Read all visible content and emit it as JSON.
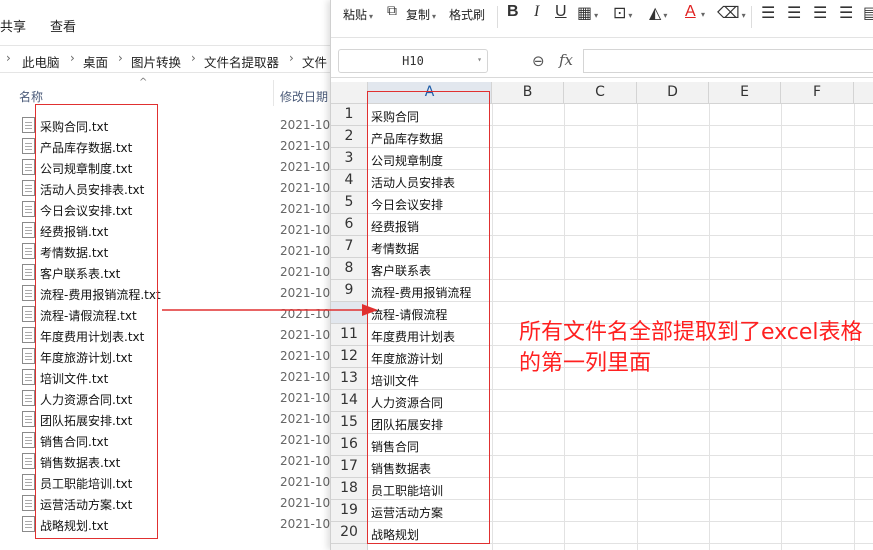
{
  "explorer": {
    "ribbon_tabs": [
      "共享",
      "查看"
    ],
    "breadcrumb": [
      "此电脑",
      "桌面",
      "图片转换",
      "文件名提取器",
      "文件"
    ],
    "columns": {
      "name": "名称",
      "date": "修改日期"
    },
    "files": [
      {
        "name": "采购合同.txt",
        "date": "2021-10-"
      },
      {
        "name": "产品库存数据.txt",
        "date": "2021-10-"
      },
      {
        "name": "公司规章制度.txt",
        "date": "2021-10-"
      },
      {
        "name": "活动人员安排表.txt",
        "date": "2021-10-"
      },
      {
        "name": "今日会议安排.txt",
        "date": "2021-10-"
      },
      {
        "name": "经费报销.txt",
        "date": "2021-10-"
      },
      {
        "name": "考情数据.txt",
        "date": "2021-10-"
      },
      {
        "name": "客户联系表.txt",
        "date": "2021-10-"
      },
      {
        "name": "流程-费用报销流程.txt",
        "date": "2021-10-"
      },
      {
        "name": "流程-请假流程.txt",
        "date": "2021-10-"
      },
      {
        "name": "年度费用计划表.txt",
        "date": "2021-10-"
      },
      {
        "name": "年度旅游计划.txt",
        "date": "2021-10-"
      },
      {
        "name": "培训文件.txt",
        "date": "2021-10-"
      },
      {
        "name": "人力资源合同.txt",
        "date": "2021-10-"
      },
      {
        "name": "团队拓展安排.txt",
        "date": "2021-10-"
      },
      {
        "name": "销售合同.txt",
        "date": "2021-10-"
      },
      {
        "name": "销售数据表.txt",
        "date": "2021-10-"
      },
      {
        "name": "员工职能培训.txt",
        "date": "2021-10-"
      },
      {
        "name": "运营活动方案.txt",
        "date": "2021-10-"
      },
      {
        "name": "战略规划.txt",
        "date": "2021-10-"
      }
    ]
  },
  "toolbar": {
    "paste_label": "粘贴",
    "copy_label": "复制",
    "format_painter_label": "格式刷",
    "bold_glyph": "B",
    "italic_glyph": "I",
    "underline_glyph": "U",
    "font_color_glyph": "A",
    "accent_red": "#e02020"
  },
  "formula_bar": {
    "cell_ref": "H10",
    "formula": ""
  },
  "sheet": {
    "columns": [
      "A",
      "B",
      "C",
      "D",
      "E",
      "F"
    ],
    "active_column": "A",
    "active_row": 10,
    "rows": [
      {
        "num": "1",
        "a": "采购合同"
      },
      {
        "num": "2",
        "a": "产品库存数据"
      },
      {
        "num": "3",
        "a": "公司规章制度"
      },
      {
        "num": "4",
        "a": "活动人员安排表"
      },
      {
        "num": "5",
        "a": "今日会议安排"
      },
      {
        "num": "6",
        "a": "经费报销"
      },
      {
        "num": "7",
        "a": "考情数据"
      },
      {
        "num": "8",
        "a": "客户联系表"
      },
      {
        "num": "9",
        "a": "流程-费用报销流程"
      },
      {
        "num": "",
        "a": "流程-请假流程"
      },
      {
        "num": "11",
        "a": "年度费用计划表"
      },
      {
        "num": "12",
        "a": "年度旅游计划"
      },
      {
        "num": "13",
        "a": "培训文件"
      },
      {
        "num": "14",
        "a": "人力资源合同"
      },
      {
        "num": "15",
        "a": "团队拓展安排"
      },
      {
        "num": "16",
        "a": "销售合同"
      },
      {
        "num": "17",
        "a": "销售数据表"
      },
      {
        "num": "18",
        "a": "员工职能培训"
      },
      {
        "num": "19",
        "a": "运营活动方案"
      },
      {
        "num": "20",
        "a": "战略规划"
      }
    ]
  },
  "annotation": {
    "text": "所有文件名全部提取到了excel表格的第一列里面",
    "color": "#ff2020"
  },
  "colors": {
    "highlight_red": "#e03030",
    "selection_green": "#2d7d3a",
    "header_gray": "#f2f2f2"
  }
}
